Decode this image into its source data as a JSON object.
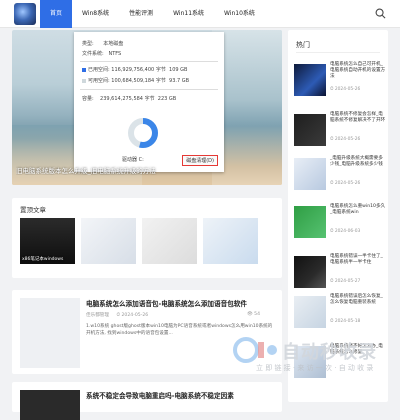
{
  "nav": {
    "items": [
      {
        "label": "首页",
        "active": true
      },
      {
        "label": "Win8系统",
        "active": false
      },
      {
        "label": "性能评测",
        "active": false
      },
      {
        "label": "Win11系统",
        "active": false
      },
      {
        "label": "Win10系统",
        "active": false
      }
    ]
  },
  "hero": {
    "caption": "旧电脑系统版本怎么升级_旧电脑系统升级的方法",
    "dialog": {
      "row1_label": "类型:",
      "row1_value": "本地磁盘",
      "row2_label": "文件系统:",
      "row2_value": "NTFS",
      "used_label": "已用空间:",
      "used_bytes": "116,929,756,400 字节",
      "used_size": "109 GB",
      "free_label": "可用空间:",
      "free_bytes": "100,684,509,184 字节",
      "free_size": "93.7 GB",
      "cap_label": "容量:",
      "cap_bytes": "239,614,275,584 字节",
      "cap_size": "223 GB",
      "drive_label": "驱动器 C:",
      "cleanup_button": "磁盘清理(D)",
      "used_fraction": 0.54
    }
  },
  "sidebar": {
    "title": "热门",
    "items": [
      {
        "text": "电脑系统怎么自己可开机_电脑系统自动开机的设置方法",
        "date": "2024-05-26"
      },
      {
        "text": "电脑系统不修复会怎样_电脑系统不修复解决不了开环",
        "date": "2024-05-26"
      },
      {
        "text": "_电脑升级系统大概需要多少钱_电脑升级系统多少钱",
        "date": "2024-05-26"
      },
      {
        "text": "电脑系统怎么重win10多久_电脑系统win",
        "date": "2024-06-03"
      },
      {
        "text": "电脑系统错误一半卡住了_电脑系统半一半卡住",
        "date": "2024-05-27"
      },
      {
        "text": "电脑系统错误后怎么恢复_怎么恢复电脑重装系统",
        "date": "2024-05-18"
      },
      {
        "text": "电脑系统修不好怎么办_电脑系统怎么修复",
        "date": ""
      }
    ]
  },
  "featured": {
    "title": "置顶文章",
    "items": [
      {
        "caption": "x86笔记本windows"
      },
      {
        "caption": ""
      },
      {
        "caption": ""
      },
      {
        "caption": ""
      }
    ]
  },
  "articles": [
    {
      "title": "电脑系统怎么添加语音包-电脑系统怎么添加语音包软件",
      "author": "佳乐都管理",
      "date": "2024-05-26",
      "count": "54",
      "desc": "1.w10系统 ghost版ghost版本win10电脑为PC语音系统或者windows怎么用win10系统的开机方法, 找到windows中的语音包设置..."
    },
    {
      "title": "系统不稳定会导致电脑重启吗-电脑系统不稳定因素"
    }
  ],
  "watermark": {
    "text": "自动秒收录",
    "sub": "立 即 链 接 · 来 访 一 次 · 自 动 收 录"
  },
  "colors": {
    "accent": "#2f6ee6",
    "background": "#f1f2f4"
  }
}
